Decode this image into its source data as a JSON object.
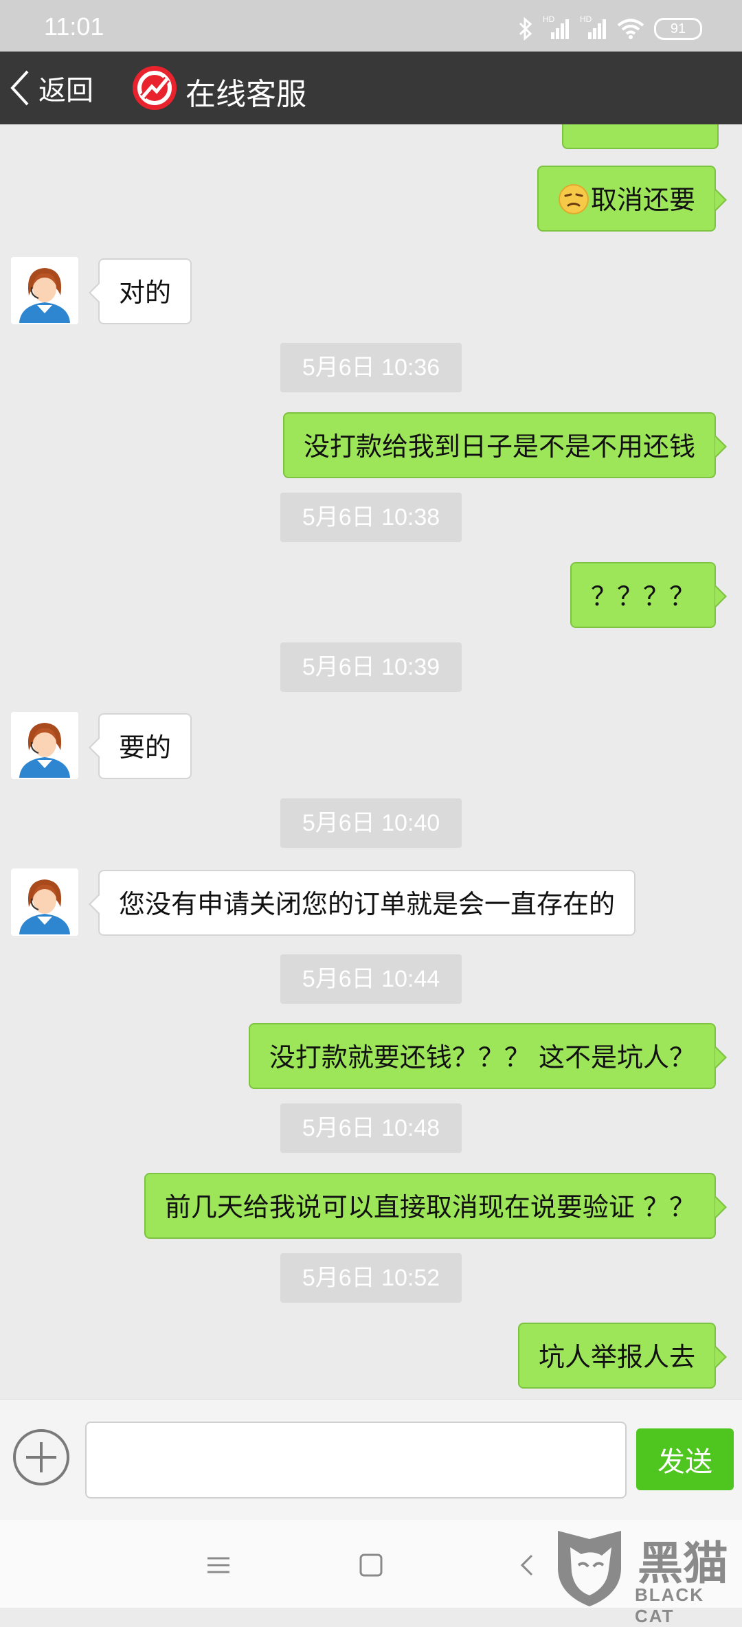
{
  "status_bar": {
    "time": "11:01",
    "battery": "91",
    "hd1": "HD",
    "hd2": "HD"
  },
  "header": {
    "back_label": "返回",
    "title": "在线客服"
  },
  "messages": [
    {
      "type": "out",
      "text": "取消还要",
      "emoji": "face-unamused-icon"
    },
    {
      "type": "in",
      "text": "对的"
    },
    {
      "type": "time",
      "text": "5月6日 10:36"
    },
    {
      "type": "out",
      "text": "没打款给我到日子是不是不用还钱"
    },
    {
      "type": "time",
      "text": "5月6日 10:38"
    },
    {
      "type": "out",
      "text": "？？？？"
    },
    {
      "type": "time",
      "text": "5月6日 10:39"
    },
    {
      "type": "in",
      "text": "要的"
    },
    {
      "type": "time",
      "text": "5月6日 10:40"
    },
    {
      "type": "in",
      "text": "您没有申请关闭您的订单就是会一直存在的"
    },
    {
      "type": "time",
      "text": "5月6日 10:44"
    },
    {
      "type": "out",
      "text": "没打款就要还钱？？？ 这不是坑人？"
    },
    {
      "type": "time",
      "text": "5月6日 10:48"
    },
    {
      "type": "out",
      "text": "前几天给我说可以直接取消现在说要验证 ？？"
    },
    {
      "type": "time",
      "text": "5月6日 10:52"
    },
    {
      "type": "out",
      "text": "坑人举报人去"
    }
  ],
  "input_bar": {
    "placeholder": "",
    "send_label": "发送"
  },
  "watermark": {
    "cn": "黑猫",
    "en": "BLACK CAT"
  },
  "colors": {
    "header_bg": "#383838",
    "out_bubble": "#9ee659",
    "send_button": "#4fc51f",
    "logo_red": "#e8232d"
  }
}
